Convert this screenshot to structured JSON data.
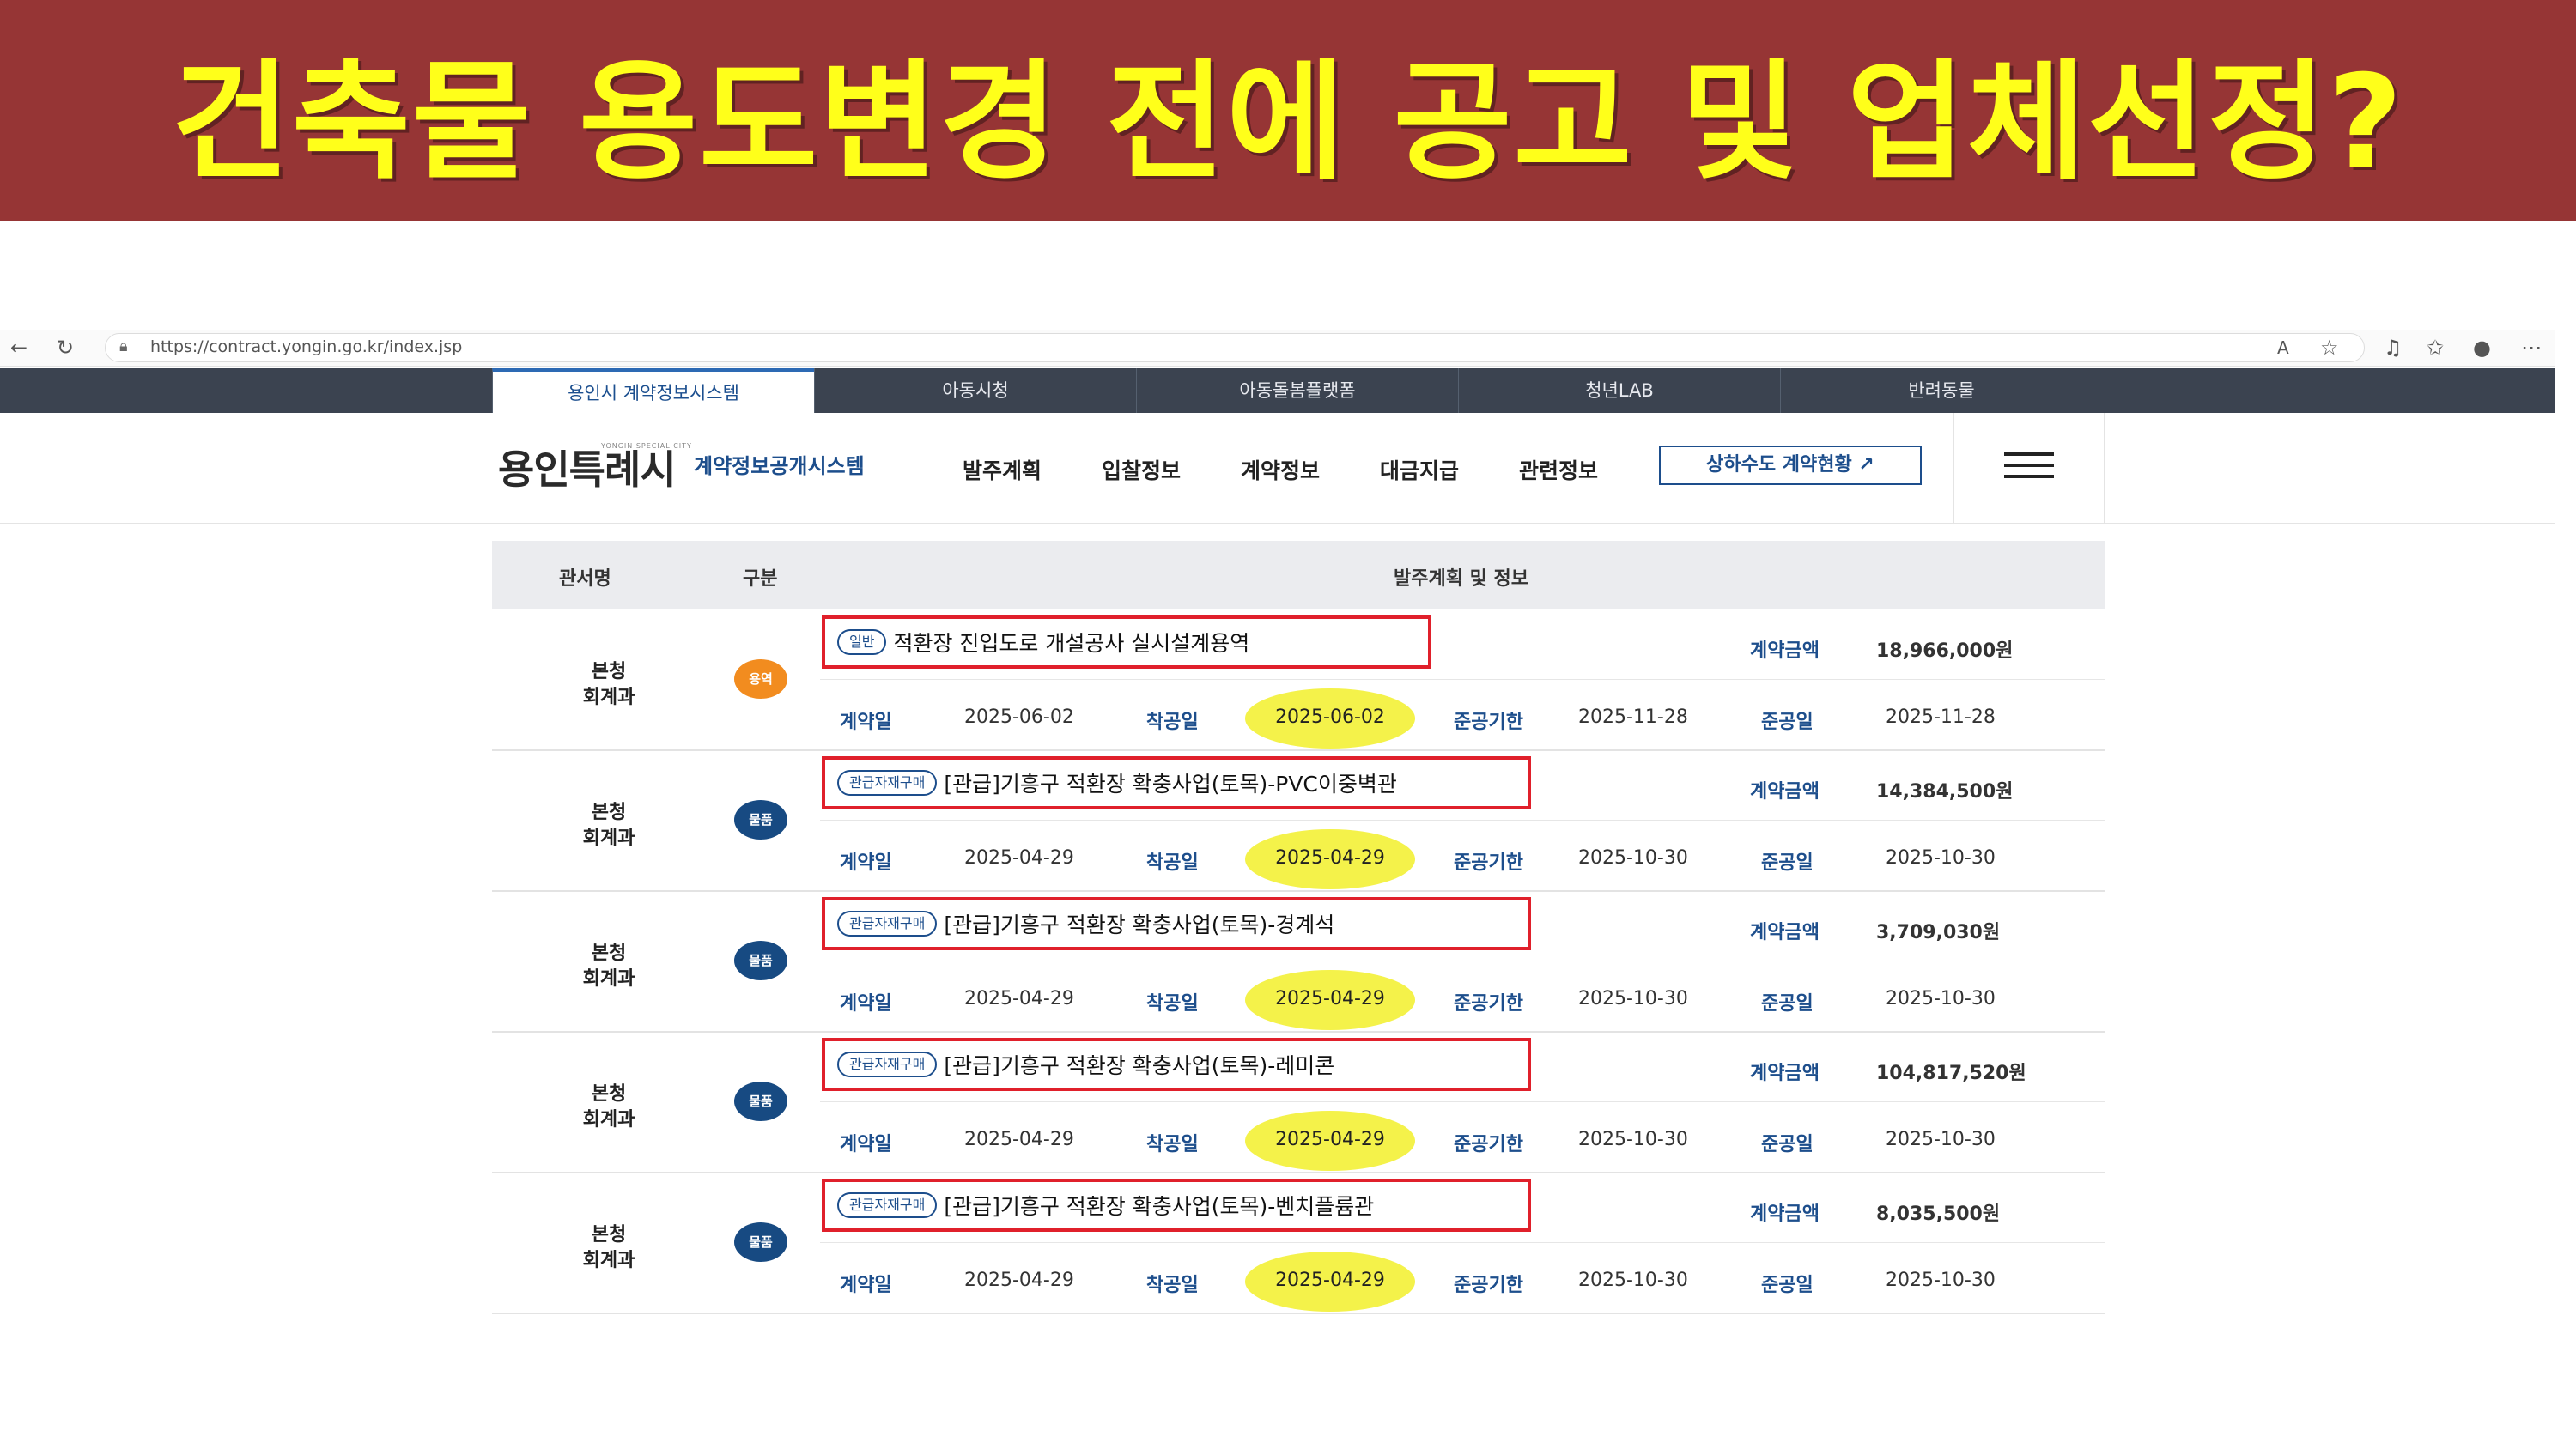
{
  "banner": {
    "title": "건축물 용도변경 전에 공고 및 업체선정?"
  },
  "browser": {
    "url": "https://contract.yongin.go.kr/index.jsp"
  },
  "topnav": {
    "tabs": [
      "용인시 계약정보시스템",
      "아동시청",
      "아동돌봄플랫폼",
      "청년LAB",
      "반려동물"
    ]
  },
  "header": {
    "logo": "용인특례시",
    "logo_sub": "YONGIN SPECIAL CITY",
    "system_name": "계약정보공개시스템",
    "menu": [
      "발주계획",
      "입찰정보",
      "계약정보",
      "대금지급",
      "관련정보"
    ],
    "water_button": "상하수도 계약현황 ↗"
  },
  "table": {
    "headers": [
      "관서명",
      "구분",
      "발주계획 및 정보"
    ],
    "labels": {
      "contract_amount": "계약금액",
      "contract_date": "계약일",
      "start_date": "착공일",
      "deadline": "준공기한",
      "completion": "준공일"
    },
    "rows": [
      {
        "dept1": "본청",
        "dept2": "회계과",
        "type": "용역",
        "type_color": "#f28c1f",
        "badge": "일반",
        "title": "적환장 진입도로 개설공사 실시설계용역",
        "amount": "18,966,000원",
        "contract_date": "2025-06-02",
        "start_date": "2025-06-02",
        "deadline": "2025-11-28",
        "completion": "2025-11-28"
      },
      {
        "dept1": "본청",
        "dept2": "회계과",
        "type": "물품",
        "type_color": "#174a82",
        "badge": "관급자재구매",
        "title": "[관급]기흥구 적환장 확충사업(토목)-PVC이중벽관",
        "amount": "14,384,500원",
        "contract_date": "2025-04-29",
        "start_date": "2025-04-29",
        "deadline": "2025-10-30",
        "completion": "2025-10-30"
      },
      {
        "dept1": "본청",
        "dept2": "회계과",
        "type": "물품",
        "type_color": "#174a82",
        "badge": "관급자재구매",
        "title": "[관급]기흥구 적환장 확충사업(토목)-경계석",
        "amount": "3,709,030원",
        "contract_date": "2025-04-29",
        "start_date": "2025-04-29",
        "deadline": "2025-10-30",
        "completion": "2025-10-30"
      },
      {
        "dept1": "본청",
        "dept2": "회계과",
        "type": "물품",
        "type_color": "#174a82",
        "badge": "관급자재구매",
        "title": "[관급]기흥구 적환장 확충사업(토목)-레미콘",
        "amount": "104,817,520원",
        "contract_date": "2025-04-29",
        "start_date": "2025-04-29",
        "deadline": "2025-10-30",
        "completion": "2025-10-30"
      },
      {
        "dept1": "본청",
        "dept2": "회계과",
        "type": "물품",
        "type_color": "#174a82",
        "badge": "관급자재구매",
        "title": "[관급]기흥구 적환장 확충사업(토목)-벤치플륨관",
        "amount": "8,035,500원",
        "contract_date": "2025-04-29",
        "start_date": "2025-04-29",
        "deadline": "2025-10-30",
        "completion": "2025-10-30"
      }
    ]
  }
}
